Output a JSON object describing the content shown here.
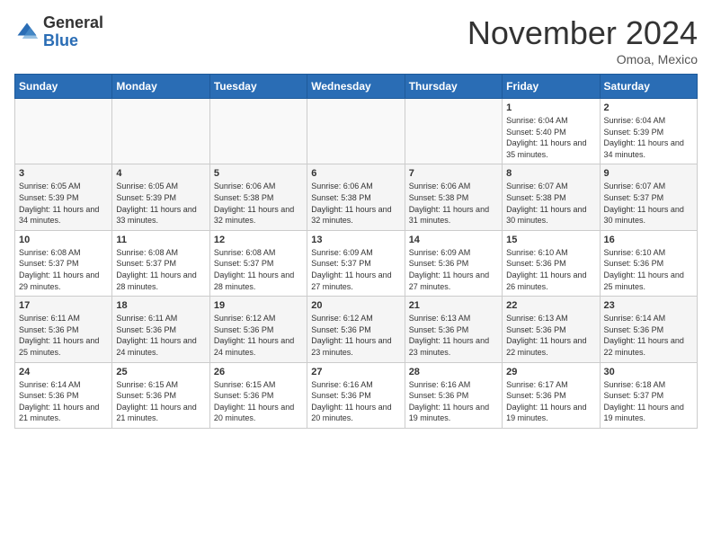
{
  "header": {
    "logo_general": "General",
    "logo_blue": "Blue",
    "month_title": "November 2024",
    "location": "Omoa, Mexico"
  },
  "weekdays": [
    "Sunday",
    "Monday",
    "Tuesday",
    "Wednesday",
    "Thursday",
    "Friday",
    "Saturday"
  ],
  "weeks": [
    [
      {
        "day": "",
        "info": ""
      },
      {
        "day": "",
        "info": ""
      },
      {
        "day": "",
        "info": ""
      },
      {
        "day": "",
        "info": ""
      },
      {
        "day": "",
        "info": ""
      },
      {
        "day": "1",
        "info": "Sunrise: 6:04 AM\nSunset: 5:40 PM\nDaylight: 11 hours and 35 minutes."
      },
      {
        "day": "2",
        "info": "Sunrise: 6:04 AM\nSunset: 5:39 PM\nDaylight: 11 hours and 34 minutes."
      }
    ],
    [
      {
        "day": "3",
        "info": "Sunrise: 6:05 AM\nSunset: 5:39 PM\nDaylight: 11 hours and 34 minutes."
      },
      {
        "day": "4",
        "info": "Sunrise: 6:05 AM\nSunset: 5:39 PM\nDaylight: 11 hours and 33 minutes."
      },
      {
        "day": "5",
        "info": "Sunrise: 6:06 AM\nSunset: 5:38 PM\nDaylight: 11 hours and 32 minutes."
      },
      {
        "day": "6",
        "info": "Sunrise: 6:06 AM\nSunset: 5:38 PM\nDaylight: 11 hours and 32 minutes."
      },
      {
        "day": "7",
        "info": "Sunrise: 6:06 AM\nSunset: 5:38 PM\nDaylight: 11 hours and 31 minutes."
      },
      {
        "day": "8",
        "info": "Sunrise: 6:07 AM\nSunset: 5:38 PM\nDaylight: 11 hours and 30 minutes."
      },
      {
        "day": "9",
        "info": "Sunrise: 6:07 AM\nSunset: 5:37 PM\nDaylight: 11 hours and 30 minutes."
      }
    ],
    [
      {
        "day": "10",
        "info": "Sunrise: 6:08 AM\nSunset: 5:37 PM\nDaylight: 11 hours and 29 minutes."
      },
      {
        "day": "11",
        "info": "Sunrise: 6:08 AM\nSunset: 5:37 PM\nDaylight: 11 hours and 28 minutes."
      },
      {
        "day": "12",
        "info": "Sunrise: 6:08 AM\nSunset: 5:37 PM\nDaylight: 11 hours and 28 minutes."
      },
      {
        "day": "13",
        "info": "Sunrise: 6:09 AM\nSunset: 5:37 PM\nDaylight: 11 hours and 27 minutes."
      },
      {
        "day": "14",
        "info": "Sunrise: 6:09 AM\nSunset: 5:36 PM\nDaylight: 11 hours and 27 minutes."
      },
      {
        "day": "15",
        "info": "Sunrise: 6:10 AM\nSunset: 5:36 PM\nDaylight: 11 hours and 26 minutes."
      },
      {
        "day": "16",
        "info": "Sunrise: 6:10 AM\nSunset: 5:36 PM\nDaylight: 11 hours and 25 minutes."
      }
    ],
    [
      {
        "day": "17",
        "info": "Sunrise: 6:11 AM\nSunset: 5:36 PM\nDaylight: 11 hours and 25 minutes."
      },
      {
        "day": "18",
        "info": "Sunrise: 6:11 AM\nSunset: 5:36 PM\nDaylight: 11 hours and 24 minutes."
      },
      {
        "day": "19",
        "info": "Sunrise: 6:12 AM\nSunset: 5:36 PM\nDaylight: 11 hours and 24 minutes."
      },
      {
        "day": "20",
        "info": "Sunrise: 6:12 AM\nSunset: 5:36 PM\nDaylight: 11 hours and 23 minutes."
      },
      {
        "day": "21",
        "info": "Sunrise: 6:13 AM\nSunset: 5:36 PM\nDaylight: 11 hours and 23 minutes."
      },
      {
        "day": "22",
        "info": "Sunrise: 6:13 AM\nSunset: 5:36 PM\nDaylight: 11 hours and 22 minutes."
      },
      {
        "day": "23",
        "info": "Sunrise: 6:14 AM\nSunset: 5:36 PM\nDaylight: 11 hours and 22 minutes."
      }
    ],
    [
      {
        "day": "24",
        "info": "Sunrise: 6:14 AM\nSunset: 5:36 PM\nDaylight: 11 hours and 21 minutes."
      },
      {
        "day": "25",
        "info": "Sunrise: 6:15 AM\nSunset: 5:36 PM\nDaylight: 11 hours and 21 minutes."
      },
      {
        "day": "26",
        "info": "Sunrise: 6:15 AM\nSunset: 5:36 PM\nDaylight: 11 hours and 20 minutes."
      },
      {
        "day": "27",
        "info": "Sunrise: 6:16 AM\nSunset: 5:36 PM\nDaylight: 11 hours and 20 minutes."
      },
      {
        "day": "28",
        "info": "Sunrise: 6:16 AM\nSunset: 5:36 PM\nDaylight: 11 hours and 19 minutes."
      },
      {
        "day": "29",
        "info": "Sunrise: 6:17 AM\nSunset: 5:36 PM\nDaylight: 11 hours and 19 minutes."
      },
      {
        "day": "30",
        "info": "Sunrise: 6:18 AM\nSunset: 5:37 PM\nDaylight: 11 hours and 19 minutes."
      }
    ]
  ]
}
